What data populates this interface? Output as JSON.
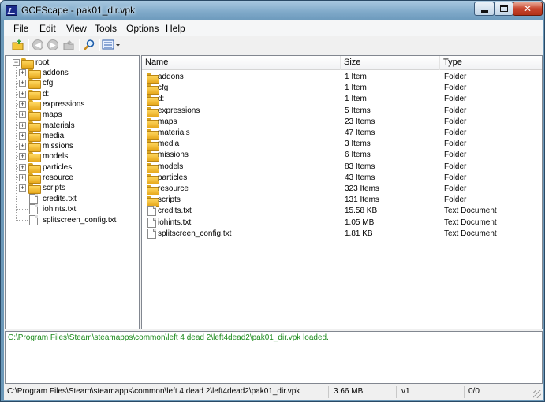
{
  "window": {
    "title": "GCFScape - pak01_dir.vpk"
  },
  "menu": [
    "File",
    "Edit",
    "View",
    "Tools",
    "Options",
    "Help"
  ],
  "toolbar": [
    "open-icon",
    "back-icon",
    "forward-icon",
    "up-icon",
    "find-icon",
    "view-icon"
  ],
  "tree": {
    "root": "root",
    "folders": [
      "addons",
      "cfg",
      "d:",
      "expressions",
      "maps",
      "materials",
      "media",
      "missions",
      "models",
      "particles",
      "resource",
      "scripts"
    ],
    "files": [
      "credits.txt",
      "iohints.txt",
      "splitscreen_config.txt"
    ]
  },
  "list": {
    "columns": {
      "name": "Name",
      "size": "Size",
      "type": "Type"
    },
    "rows": [
      {
        "name": "addons",
        "size": "1 Item",
        "type": "Folder",
        "icon": "folder"
      },
      {
        "name": "cfg",
        "size": "1 Item",
        "type": "Folder",
        "icon": "folder"
      },
      {
        "name": "d:",
        "size": "1 Item",
        "type": "Folder",
        "icon": "folder"
      },
      {
        "name": "expressions",
        "size": "5 Items",
        "type": "Folder",
        "icon": "folder"
      },
      {
        "name": "maps",
        "size": "23 Items",
        "type": "Folder",
        "icon": "folder"
      },
      {
        "name": "materials",
        "size": "47 Items",
        "type": "Folder",
        "icon": "folder"
      },
      {
        "name": "media",
        "size": "3 Items",
        "type": "Folder",
        "icon": "folder"
      },
      {
        "name": "missions",
        "size": "6 Items",
        "type": "Folder",
        "icon": "folder"
      },
      {
        "name": "models",
        "size": "83 Items",
        "type": "Folder",
        "icon": "folder"
      },
      {
        "name": "particles",
        "size": "43 Items",
        "type": "Folder",
        "icon": "folder"
      },
      {
        "name": "resource",
        "size": "323 Items",
        "type": "Folder",
        "icon": "folder"
      },
      {
        "name": "scripts",
        "size": "131 Items",
        "type": "Folder",
        "icon": "folder"
      },
      {
        "name": "credits.txt",
        "size": "15.58 KB",
        "type": "Text Document",
        "icon": "document"
      },
      {
        "name": "iohints.txt",
        "size": "1.05 MB",
        "type": "Text Document",
        "icon": "document"
      },
      {
        "name": "splitscreen_config.txt",
        "size": "1.81 KB",
        "type": "Text Document",
        "icon": "document"
      }
    ]
  },
  "log": {
    "line": "C:\\Program Files\\Steam\\steamapps\\common\\left 4 dead 2\\left4dead2\\pak01_dir.vpk loaded."
  },
  "status": {
    "path": "C:\\Program Files\\Steam\\steamapps\\common\\left 4 dead 2\\left4dead2\\pak01_dir.vpk",
    "size": "3.66 MB",
    "version": "v1",
    "fragmentation": "0/0"
  },
  "colors": {
    "log_text": "#1a8a1a",
    "folder": "#f0c040",
    "titlebar": "#7fa9c9"
  }
}
